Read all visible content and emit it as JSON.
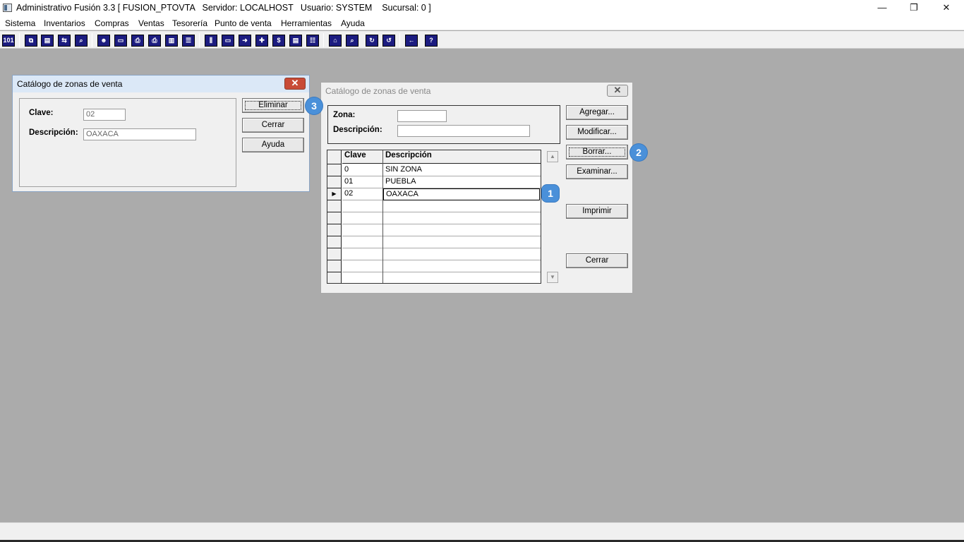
{
  "window": {
    "title": "Administrativo Fusión 3.3 [ FUSION_PTOVTA   Servidor: LOCALHOST   Usuario: SYSTEM    Sucursal: 0 ]",
    "minimize": "—",
    "restore": "❐",
    "close": "✕"
  },
  "menu": [
    "Sistema",
    "Inventarios",
    "Compras",
    "Ventas",
    "Tesorería",
    "Punto de venta",
    "Herramientas",
    "Ayuda"
  ],
  "toolbar_icons": [
    "numeric-icon",
    "copy-icon",
    "clipboard-icon",
    "swap-icon",
    "zoom-icon",
    "user-icon",
    "folder-icon",
    "print-icon",
    "printer-icon",
    "document-icon",
    "list-icon",
    "columns-icon",
    "folder-open-icon",
    "export-icon",
    "add-icon",
    "dollar-icon",
    "report-icon",
    "table-icon",
    "home-icon",
    "search-icon",
    "refresh-icon",
    "undo-icon",
    "back-icon",
    "help-icon"
  ],
  "dialog_delete": {
    "title": "Catálogo de zonas de venta",
    "clave_label": "Clave:",
    "clave_value": "02",
    "descripcion_label": "Descripción:",
    "descripcion_value": "OAXACA",
    "btn_eliminar": "Eliminar",
    "btn_cerrar": "Cerrar",
    "btn_ayuda": "Ayuda"
  },
  "dialog_catalog": {
    "title": "Catálogo de zonas de venta",
    "zona_label": "Zona:",
    "zona_value": "",
    "descripcion_label": "Descripción:",
    "descripcion_value": "",
    "columns": [
      "Clave",
      "Descripción"
    ],
    "rows": [
      {
        "clave": "0",
        "descripcion": "SIN ZONA"
      },
      {
        "clave": "01",
        "descripcion": "PUEBLA"
      },
      {
        "clave": "02",
        "descripcion": "OAXACA"
      }
    ],
    "selected_indicator": "▶",
    "buttons": {
      "agregar": "Agregar...",
      "modificar": "Modificar...",
      "borrar": "Borrar...",
      "examinar": "Examinar...",
      "imprimir": "Imprimir",
      "cerrar": "Cerrar"
    }
  },
  "badges": {
    "one": "1",
    "two": "2",
    "three": "3"
  },
  "colors": {
    "desktop": "#ababab",
    "toolbar_icon": "#1c1c80",
    "badge": "#4a90d9",
    "close_active": "#c84b37"
  }
}
